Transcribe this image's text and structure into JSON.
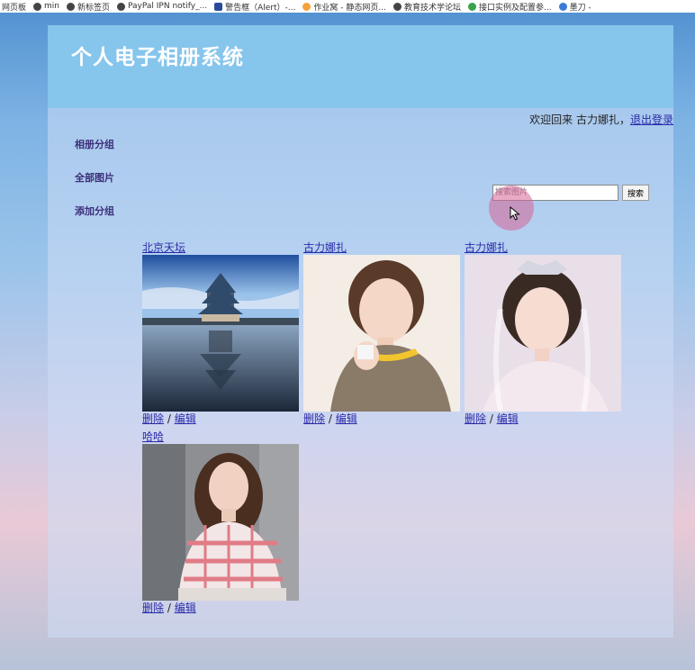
{
  "bookmarks": [
    {
      "label": "网页板",
      "icon": "page-icon"
    },
    {
      "label": "min",
      "icon": "globe-icon"
    },
    {
      "label": "新标签页",
      "icon": "globe-icon"
    },
    {
      "label": "PayPal IPN notify_...",
      "icon": "paypal-icon"
    },
    {
      "label": "警告框（Alert）-...",
      "icon": "bootstrap-icon"
    },
    {
      "label": "作业窝 - 静态网页...",
      "icon": "homework-icon"
    },
    {
      "label": "教育技术学论坛",
      "icon": "globe-icon"
    },
    {
      "label": "接口实例及配置参...",
      "icon": "api-icon"
    },
    {
      "label": "墨刀 -",
      "icon": "modao-icon"
    }
  ],
  "header": {
    "title": "个人电子相册系统"
  },
  "welcome": {
    "text": "欢迎回来 古力娜扎，",
    "logout": "退出登录"
  },
  "sidebar": {
    "items": [
      "相册分组",
      "全部图片",
      "添加分组"
    ]
  },
  "search": {
    "placeholder": "搜索图片",
    "button": "搜索"
  },
  "photos": [
    {
      "title": "北京天坛",
      "delete": "删除",
      "sep": "/",
      "edit": "编辑"
    },
    {
      "title": "古力娜扎",
      "delete": "删除",
      "sep": "/",
      "edit": "编辑"
    },
    {
      "title": "古力娜扎",
      "delete": "删除",
      "sep": "/",
      "edit": "编辑"
    },
    {
      "title": "哈哈",
      "delete": "删除",
      "sep": "/",
      "edit": "编辑"
    }
  ]
}
